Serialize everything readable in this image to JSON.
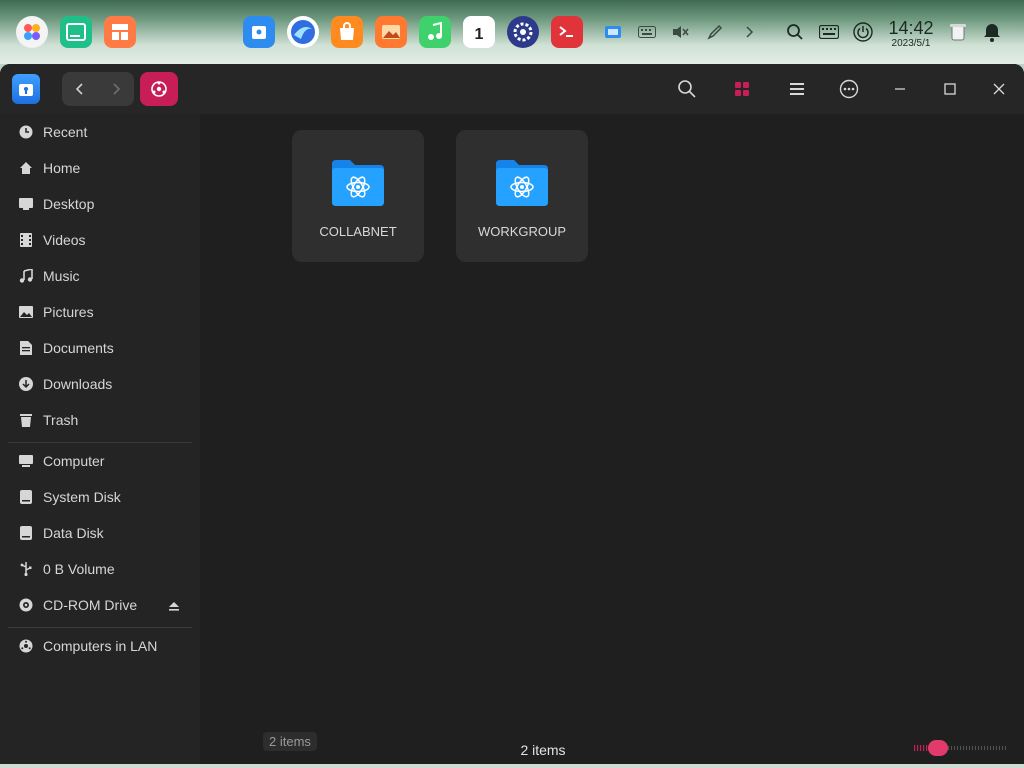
{
  "dock": {
    "apps": [
      {
        "name": "launcher-icon",
        "color": "#ffffff"
      },
      {
        "name": "terminal-green-icon",
        "color": "#1fbf8a"
      },
      {
        "name": "app-store-icon",
        "color": "#ff7a45"
      },
      {
        "name": "file-manager-icon",
        "color": "#2e8cf0"
      },
      {
        "name": "browser-icon",
        "color": "#2f6de1"
      },
      {
        "name": "shop-icon",
        "color": "#ff8a1f"
      },
      {
        "name": "image-viewer-icon",
        "color": "#ff7a30"
      },
      {
        "name": "music-icon",
        "color": "#3fd16b"
      },
      {
        "name": "calendar-icon",
        "color": "#ffffff"
      },
      {
        "name": "settings-icon",
        "color": "#2d3a8c"
      },
      {
        "name": "terminal-icon",
        "color": "#e0343a"
      }
    ],
    "calendar_day": "1",
    "clock_time": "14:42",
    "clock_date": "2023/5/1"
  },
  "sidebar": {
    "items": [
      {
        "label": "Recent",
        "icon": "clock-icon"
      },
      {
        "label": "Home",
        "icon": "home-icon"
      },
      {
        "label": "Desktop",
        "icon": "desktop-icon"
      },
      {
        "label": "Videos",
        "icon": "video-icon"
      },
      {
        "label": "Music",
        "icon": "music-note-icon"
      },
      {
        "label": "Pictures",
        "icon": "picture-icon"
      },
      {
        "label": "Documents",
        "icon": "document-icon"
      },
      {
        "label": "Downloads",
        "icon": "download-icon"
      },
      {
        "label": "Trash",
        "icon": "trash-icon"
      },
      {
        "label": "Computer",
        "icon": "computer-icon"
      },
      {
        "label": "System Disk",
        "icon": "disk-icon"
      },
      {
        "label": "Data Disk",
        "icon": "disk-icon"
      },
      {
        "label": "0 B Volume",
        "icon": "usb-icon"
      },
      {
        "label": "CD-ROM Drive",
        "icon": "cdrom-icon"
      },
      {
        "label": "Computers in LAN",
        "icon": "network-icon"
      }
    ]
  },
  "content": {
    "items": [
      {
        "label": "COLLABNET",
        "icon": "network-folder-icon"
      },
      {
        "label": "WORKGROUP",
        "icon": "network-folder-icon"
      }
    ],
    "status_text": "2 items",
    "tooltip_text": "2 items"
  },
  "colors": {
    "accent": "#c81e57",
    "folder_blue": "#1e9bff",
    "window_bg": "#242424"
  }
}
